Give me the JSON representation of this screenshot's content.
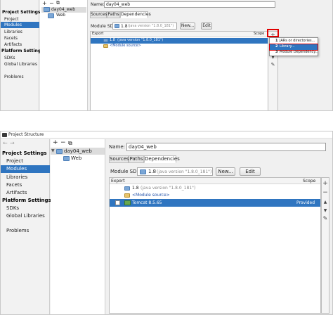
{
  "top": {
    "nav": {
      "sections": [
        {
          "header": "Project Settings",
          "items": [
            "Project",
            "Modules",
            "Libraries",
            "Facets",
            "Artifacts"
          ]
        },
        {
          "header": "Platform Settings",
          "items": [
            "SDKs",
            "Global Libraries"
          ]
        }
      ],
      "problems": "Problems",
      "selected": "Modules"
    },
    "toolbar": {
      "add": "+",
      "remove": "−",
      "copy": "⧉"
    },
    "tree": {
      "root": "day04_web",
      "child": "Web"
    },
    "name_label": "Name:",
    "name_value": "day04_web",
    "tabs": [
      "Sources",
      "Paths",
      "Dependencies"
    ],
    "module_sdk_label": "Module SDK:",
    "sdk_version": "1.8",
    "sdk_detail": "(java version \"1.8.0_181\")",
    "new_label": "New...",
    "edit_label": "Edit",
    "table": {
      "col_export": "Export",
      "col_scope": "Scope",
      "rows": [
        {
          "name": "1.8",
          "detail": "(java version \"1.8.0_181\")"
        },
        {
          "name": "<Module source>",
          "detail": ""
        }
      ]
    },
    "side": {
      "add": "+",
      "remove": "−",
      "up": "▲",
      "down": "▼",
      "edit": "✎"
    },
    "popup": [
      {
        "num": "1",
        "label": "JARs or directories..."
      },
      {
        "num": "2",
        "label": "Library..."
      },
      {
        "num": "3",
        "label": "Module Dependency..."
      }
    ]
  },
  "bottom": {
    "title": "Project Structure",
    "back": "←",
    "forward": "→",
    "nav": {
      "sections": [
        {
          "header": "Project Settings",
          "items": [
            "Project",
            "Modules",
            "Libraries",
            "Facets",
            "Artifacts"
          ]
        },
        {
          "header": "Platform Settings",
          "items": [
            "SDKs",
            "Global Libraries"
          ]
        }
      ],
      "problems": "Problems",
      "selected": "Modules"
    },
    "toolbar": {
      "add": "+",
      "remove": "−",
      "copy": "⧉"
    },
    "tree": {
      "root": "day04_web",
      "child": "Web",
      "expander": "▼"
    },
    "name_label": "Name:",
    "name_value": "day04_web",
    "tabs": [
      "Sources",
      "Paths",
      "Dependencies"
    ],
    "module_sdk_label": "Module SDK:",
    "sdk_version": "1.8",
    "sdk_detail": "(java version \"1.8.0_181\")",
    "new_label": "New...",
    "edit_label": "Edit",
    "table": {
      "col_export": "Export",
      "col_scope": "Scope",
      "rows": [
        {
          "name": "1.8",
          "detail": "(java version \"1.8.0_181\")",
          "scope": ""
        },
        {
          "name": "<Module source>",
          "detail": "",
          "scope": ""
        },
        {
          "name": "Tomcat 8.5.65",
          "detail": "",
          "scope": "Provided"
        }
      ]
    },
    "side": {
      "add": "+",
      "remove": "−",
      "up": "▲",
      "down": "▼",
      "edit": "✎"
    }
  },
  "colors": {
    "selection": "#2f75c0",
    "highlight_box": "#e00000"
  }
}
